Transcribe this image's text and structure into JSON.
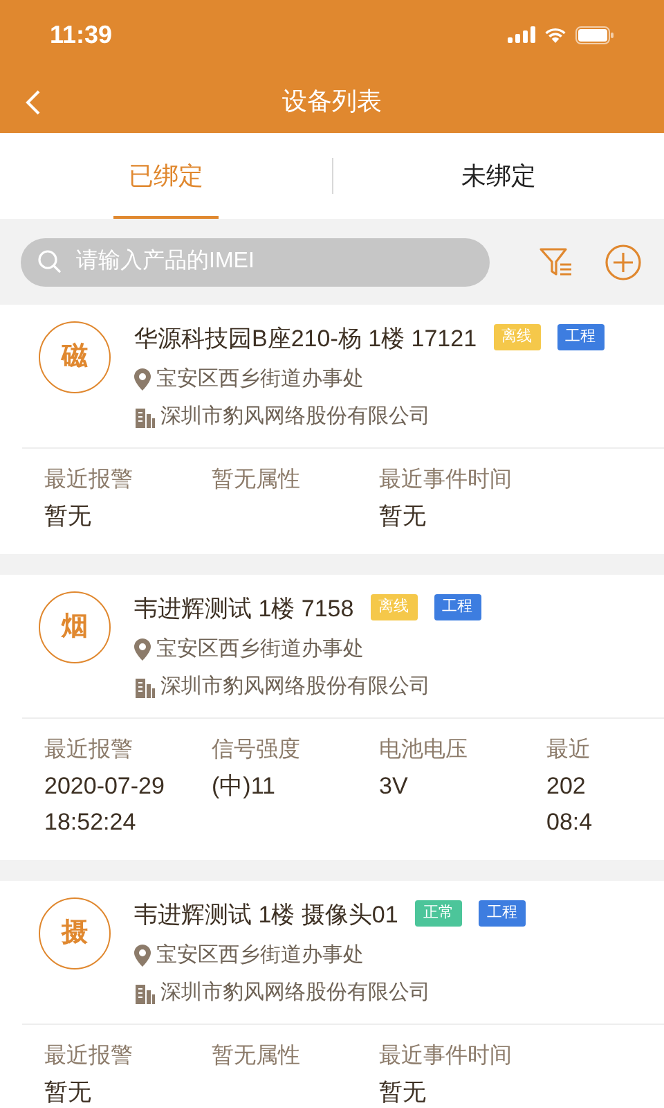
{
  "status_bar": {
    "time": "11:39"
  },
  "nav": {
    "title": "设备列表"
  },
  "tabs": [
    {
      "label": "已绑定",
      "selected": true
    },
    {
      "label": "未绑定",
      "selected": false
    }
  ],
  "search": {
    "placeholder": "请输入产品的IMEI"
  },
  "devices": [
    {
      "avatar": "磁",
      "name": "华源科技园B座210-杨 1楼 17121",
      "tags": [
        {
          "label": "离线",
          "color": "#f5c84a"
        },
        {
          "label": "工程",
          "color": "#3d7de0"
        }
      ],
      "location": "宝安区西乡街道办事处",
      "company": "深圳市豹风网络股份有限公司",
      "stats": [
        {
          "label": "最近报警",
          "lines": [
            "暂无"
          ]
        },
        {
          "label": "暂无属性"
        },
        {
          "label": "最近事件时间",
          "lines": [
            "暂无"
          ]
        }
      ]
    },
    {
      "avatar": "烟",
      "name": "韦进辉测试 1楼 7158",
      "tags": [
        {
          "label": "离线",
          "color": "#f5c84a"
        },
        {
          "label": "工程",
          "color": "#3d7de0"
        }
      ],
      "location": "宝安区西乡街道办事处",
      "company": "深圳市豹风网络股份有限公司",
      "stats": [
        {
          "label": "最近报警",
          "lines": [
            "2020-07-29",
            "18:52:24"
          ]
        },
        {
          "label": "信号强度",
          "lines": [
            "(中)11"
          ]
        },
        {
          "label": "电池电压",
          "lines": [
            "3V"
          ]
        },
        {
          "label": "最近",
          "lines": [
            "202",
            "08:4"
          ]
        }
      ]
    },
    {
      "avatar": "摄",
      "name": "韦进辉测试 1楼 摄像头01",
      "tags": [
        {
          "label": "正常",
          "color": "#4cc59a"
        },
        {
          "label": "工程",
          "color": "#3d7de0"
        }
      ],
      "location": "宝安区西乡街道办事处",
      "company": "深圳市豹风网络股份有限公司",
      "stats": [
        {
          "label": "最近报警",
          "lines": [
            "暂无"
          ]
        },
        {
          "label": "暂无属性"
        },
        {
          "label": "最近事件时间",
          "lines": [
            "暂无"
          ]
        }
      ]
    }
  ]
}
